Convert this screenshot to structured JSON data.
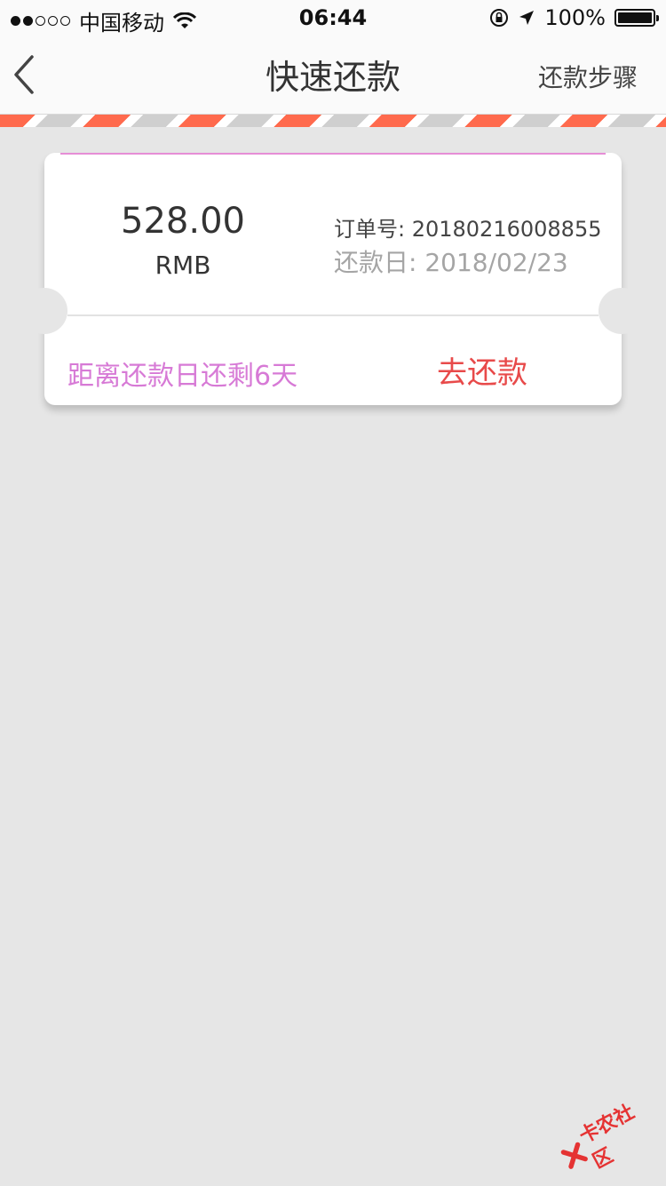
{
  "status_bar": {
    "carrier": "中国移动",
    "time": "06:44",
    "battery": "100%"
  },
  "nav": {
    "title": "快速还款",
    "right_action": "还款步骤"
  },
  "card": {
    "amount": "528.00",
    "currency": "RMB",
    "order_label": "订单号: 20180216008855",
    "due_label": "还款日: 2018/02/23",
    "countdown": "距离还款日还剩6天",
    "pay_button": "去还款"
  },
  "watermark": {
    "text": "卡农社区"
  },
  "colors": {
    "accent_red": "#e84a4a",
    "accent_pink": "#d77ad6",
    "stripe_red": "#ff6a4d"
  }
}
